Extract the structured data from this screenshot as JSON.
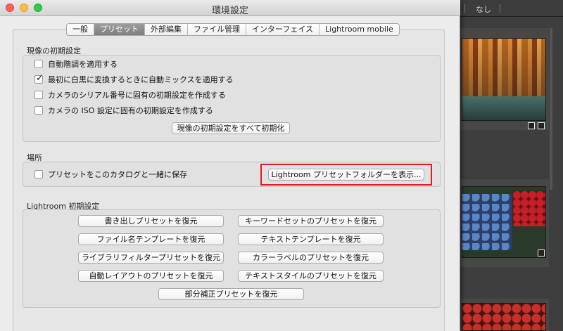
{
  "window": {
    "title": "環境設定"
  },
  "tabs": [
    {
      "label": "一般"
    },
    {
      "label": "プリセット",
      "active": true
    },
    {
      "label": "外部編集"
    },
    {
      "label": "ファイル管理"
    },
    {
      "label": "インターフェイス"
    },
    {
      "label": "Lightroom mobile"
    }
  ],
  "camera_defaults": {
    "title": "現像の初期設定",
    "options": [
      {
        "label": "自動階調を適用する",
        "checked": false
      },
      {
        "label": "最初に白黒に変換するときに自動ミックスを適用する",
        "checked": true
      },
      {
        "label": "カメラのシリアル番号に固有の初期設定を作成する",
        "checked": false
      },
      {
        "label": "カメラの ISO 設定に固有の初期設定を作成する",
        "checked": false
      }
    ],
    "reset_button": "現像の初期設定をすべて初期化"
  },
  "location": {
    "title": "場所",
    "store_with_catalog": {
      "label": "プリセットをこのカタログと一緒に保存",
      "checked": false
    },
    "show_folder_button": "Lightroom プリセットフォルダーを表示..."
  },
  "lightroom_defaults": {
    "title": "Lightroom 初期設定",
    "buttons": {
      "export_presets": "書き出しプリセットを復元",
      "keyword_presets": "キーワードセットのプリセットを復元",
      "filename_templates": "ファイル名テンプレートを復元",
      "text_templates": "テキストテンプレートを復元",
      "library_filter_presets": "ライブラリフィルタープリセットを復元",
      "color_label_presets": "カラーラベルのプリセットを復元",
      "auto_layout_presets": "自動レイアウトのプリセットを復元",
      "text_style_presets": "テキストスタイルのプリセットを復元",
      "local_adjustment_presets": "部分補正プリセットを復元"
    }
  },
  "background_app": {
    "filter_label": "なし"
  },
  "colors": {
    "highlight": "#e01b24",
    "active_tab": "#8a8a8a"
  }
}
